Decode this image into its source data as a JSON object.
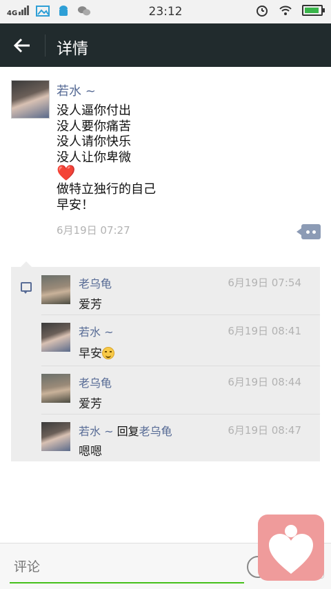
{
  "status_bar": {
    "network": "4G",
    "time": "23:12",
    "icons": [
      "signal-icon",
      "gallery-icon",
      "android-icon",
      "wechat-icon",
      "alarm-icon",
      "wifi-icon",
      "battery-icon"
    ]
  },
  "header": {
    "title": "详情",
    "back_icon": "back-arrow-icon",
    "background": "#212b2d"
  },
  "post": {
    "author": "若水 ~",
    "lines": [
      "没人逼你付出",
      "没人要你痛苦",
      "没人请你快乐",
      "没人让你卑微"
    ],
    "heart": "❤️",
    "lines2": [
      "做特立独行的自己",
      "早安！"
    ],
    "time": "6月19日 07:27"
  },
  "comments": [
    {
      "name": "老乌龟",
      "time": "6月19日 07:54",
      "text": "爱芳",
      "avatar": "boy"
    },
    {
      "name": "若水 ~",
      "time": "6月19日 08:41",
      "text": "早安",
      "emoji": "smile-emoji",
      "avatar": "girl"
    },
    {
      "name": "老乌龟",
      "time": "6月19日 08:44",
      "text": "爱芳",
      "avatar": "boy"
    },
    {
      "name": "若水 ~",
      "reply_word": "回复",
      "reply_to": "老乌龟",
      "time": "6月19日 08:47",
      "text": "嗯嗯",
      "avatar": "girl"
    }
  ],
  "input": {
    "placeholder": "评论"
  },
  "colors": {
    "link": "#576b95",
    "accent": "#45c01a",
    "comment_bg": "#ededed"
  }
}
